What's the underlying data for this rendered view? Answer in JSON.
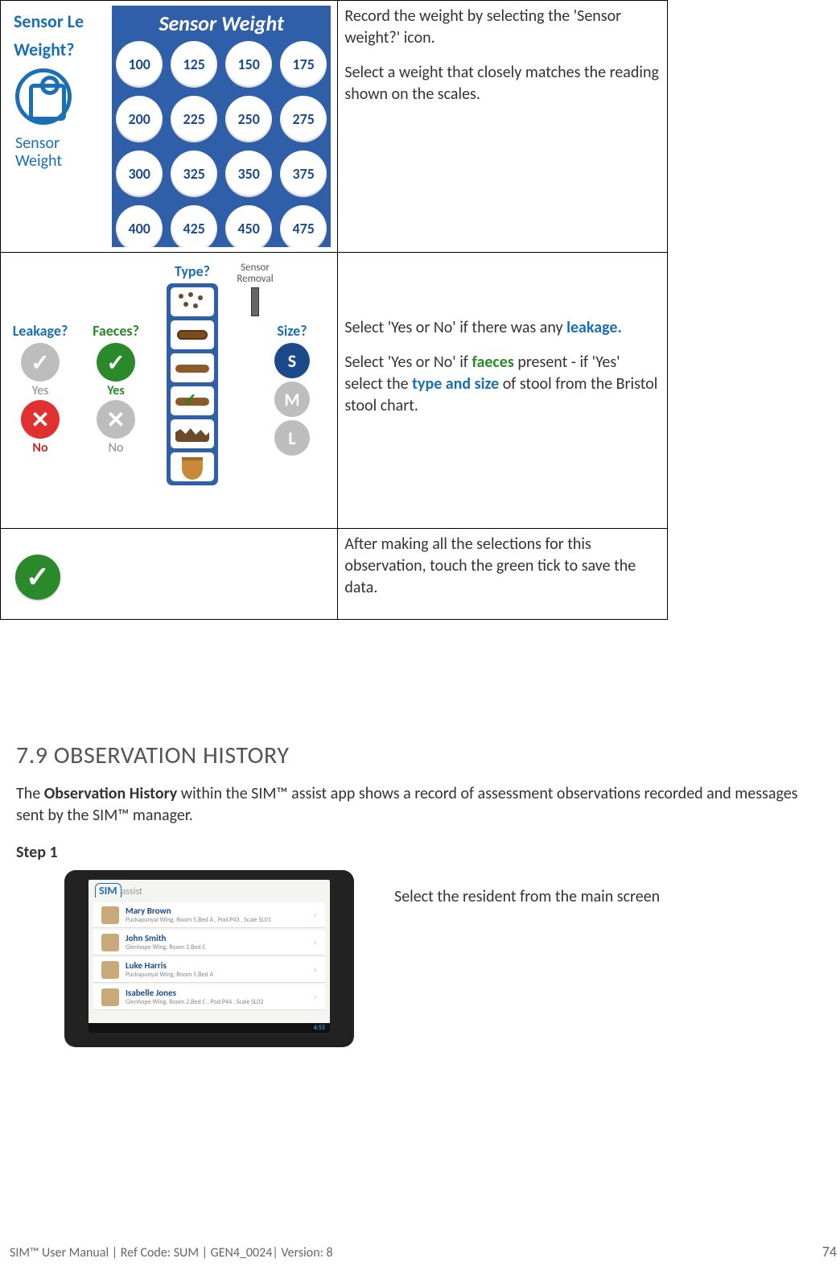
{
  "row1": {
    "label_top": "Sensor Le",
    "question": "Weight?",
    "caption_line1": "Sensor",
    "caption_line2": "Weight",
    "panel_title": "Sensor Weight",
    "weights": [
      "100",
      "125",
      "150",
      "175",
      "200",
      "225",
      "250",
      "275",
      "300",
      "325",
      "350",
      "375",
      "400",
      "425",
      "450",
      "475"
    ],
    "instr1": "Record the weight by selecting the 'Sensor weight?' icon.",
    "instr2": "Select a weight that closely matches the reading shown on the scales."
  },
  "row2": {
    "leak_hdr": "Leakage?",
    "faec_hdr": "Faeces?",
    "type_hdr": "Type?",
    "removal_hdr": "Sensor Removal",
    "size_hdr": "Size?",
    "yes": "Yes",
    "no": "No",
    "size_s": "S",
    "size_m": "M",
    "size_l": "L",
    "instr_a_pre": "Select 'Yes or No' if there was any ",
    "instr_a_hl": "leakage.",
    "instr_b_pre": "Select 'Yes or No' if ",
    "instr_b_hl1": "faeces",
    "instr_b_mid": " present - if 'Yes' select the ",
    "instr_b_hl2": "type and size",
    "instr_b_post": " of stool from the Bristol stool chart."
  },
  "row3": {
    "instr": "After making all the selections for this observation, touch the green tick to save the data."
  },
  "section": {
    "heading": "7.9 OBSERVATION HISTORY",
    "p_pre": "The ",
    "p_bold": "Observation History",
    "p_post": " within the SIM™ assist app shows a record of assessment observations recorded and messages sent by the SIM™ manager.",
    "step": "Step 1",
    "step_instr": "Select the resident from the main screen"
  },
  "app": {
    "logo_sim": "SIM",
    "logo_assist": "assist",
    "status_time": "4:55",
    "residents": [
      {
        "name": "Mary Brown",
        "detail": "Puckapunyal Wing, Room 5,Bed A , Pod:P43 , Scale SL01"
      },
      {
        "name": "John Smith",
        "detail": "Glenhope Wing, Room 2,Bed C"
      },
      {
        "name": "Luke Harris",
        "detail": "Puckapunyal Wing, Room 5,Bed A"
      },
      {
        "name": "Isabelle Jones",
        "detail": "Glenhope Wing, Room 2,Bed C , Pod:P44 , Scale SL02"
      }
    ]
  },
  "footer": {
    "text": "SIM™ User Manual | Ref Code: SUM | GEN4_0024| Version: 8",
    "page": "74"
  }
}
